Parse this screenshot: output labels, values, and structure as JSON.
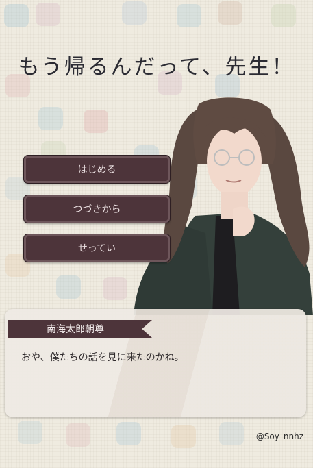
{
  "game_title": "もう帰るんだって、先生！",
  "menu": {
    "start_label": "はじめる",
    "continue_label": "つづきから",
    "settings_label": "せってい"
  },
  "dialogue": {
    "speaker": "南海太郎朝尊",
    "text": "おや、僕たちの話を見に来たのかね。"
  },
  "credit": "@Soy_nnhz",
  "colors": {
    "button_bg": "#4d343a",
    "button_border": "#6e565b",
    "background": "#efebe0",
    "dialog_bg": "#e9e3db"
  }
}
